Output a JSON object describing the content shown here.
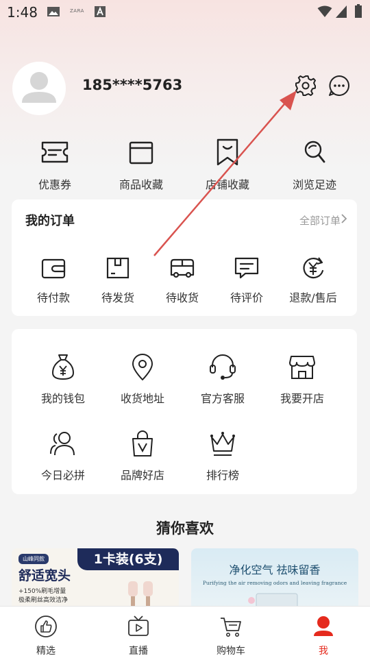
{
  "status_bar": {
    "time": "1:48",
    "notif_text": "ZARA"
  },
  "profile": {
    "phone": "185****5763"
  },
  "quick_row": [
    {
      "label": "优惠券",
      "icon": "ticket-icon"
    },
    {
      "label": "商品收藏",
      "icon": "box-star-icon"
    },
    {
      "label": "店铺收藏",
      "icon": "bookmark-icon"
    },
    {
      "label": "浏览足迹",
      "icon": "footprint-icon"
    }
  ],
  "orders": {
    "title": "我的订单",
    "all_label": "全部订单",
    "items": [
      {
        "label": "待付款",
        "icon": "wallet-icon"
      },
      {
        "label": "待发货",
        "icon": "package-icon"
      },
      {
        "label": "待收货",
        "icon": "truck-icon"
      },
      {
        "label": "待评价",
        "icon": "comment-icon"
      },
      {
        "label": "退款/售后",
        "icon": "refund-icon"
      }
    ]
  },
  "services": [
    {
      "label": "我的钱包",
      "icon": "money-bag-icon"
    },
    {
      "label": "收货地址",
      "icon": "location-icon"
    },
    {
      "label": "官方客服",
      "icon": "headset-icon"
    },
    {
      "label": "我要开店",
      "icon": "store-icon"
    },
    {
      "label": "今日必拼",
      "icon": "group-icon"
    },
    {
      "label": "品牌好店",
      "icon": "shopping-bag-icon"
    },
    {
      "label": "排行榜",
      "icon": "crown-icon"
    }
  ],
  "guess": {
    "title": "猜你喜欢"
  },
  "products": [
    {
      "badge": "山峰同款",
      "headline": "舒适宽头",
      "pack": "1卡装(6支)",
      "line1": "+150%刷毛增量",
      "line2": "极柔刷丝高效洁净"
    },
    {
      "headline": "净化空气 祛味留香",
      "subline": "Purifying the air removing odors and leaving fragrance"
    }
  ],
  "tabs": [
    {
      "label": "精选",
      "icon": "thumbs-up-icon"
    },
    {
      "label": "直播",
      "icon": "tv-play-icon"
    },
    {
      "label": "购物车",
      "icon": "cart-icon"
    },
    {
      "label": "我",
      "icon": "profile-icon",
      "active": true
    }
  ],
  "colors": {
    "accent": "#e52a1d",
    "annotation_arrow": "#d9534f"
  }
}
